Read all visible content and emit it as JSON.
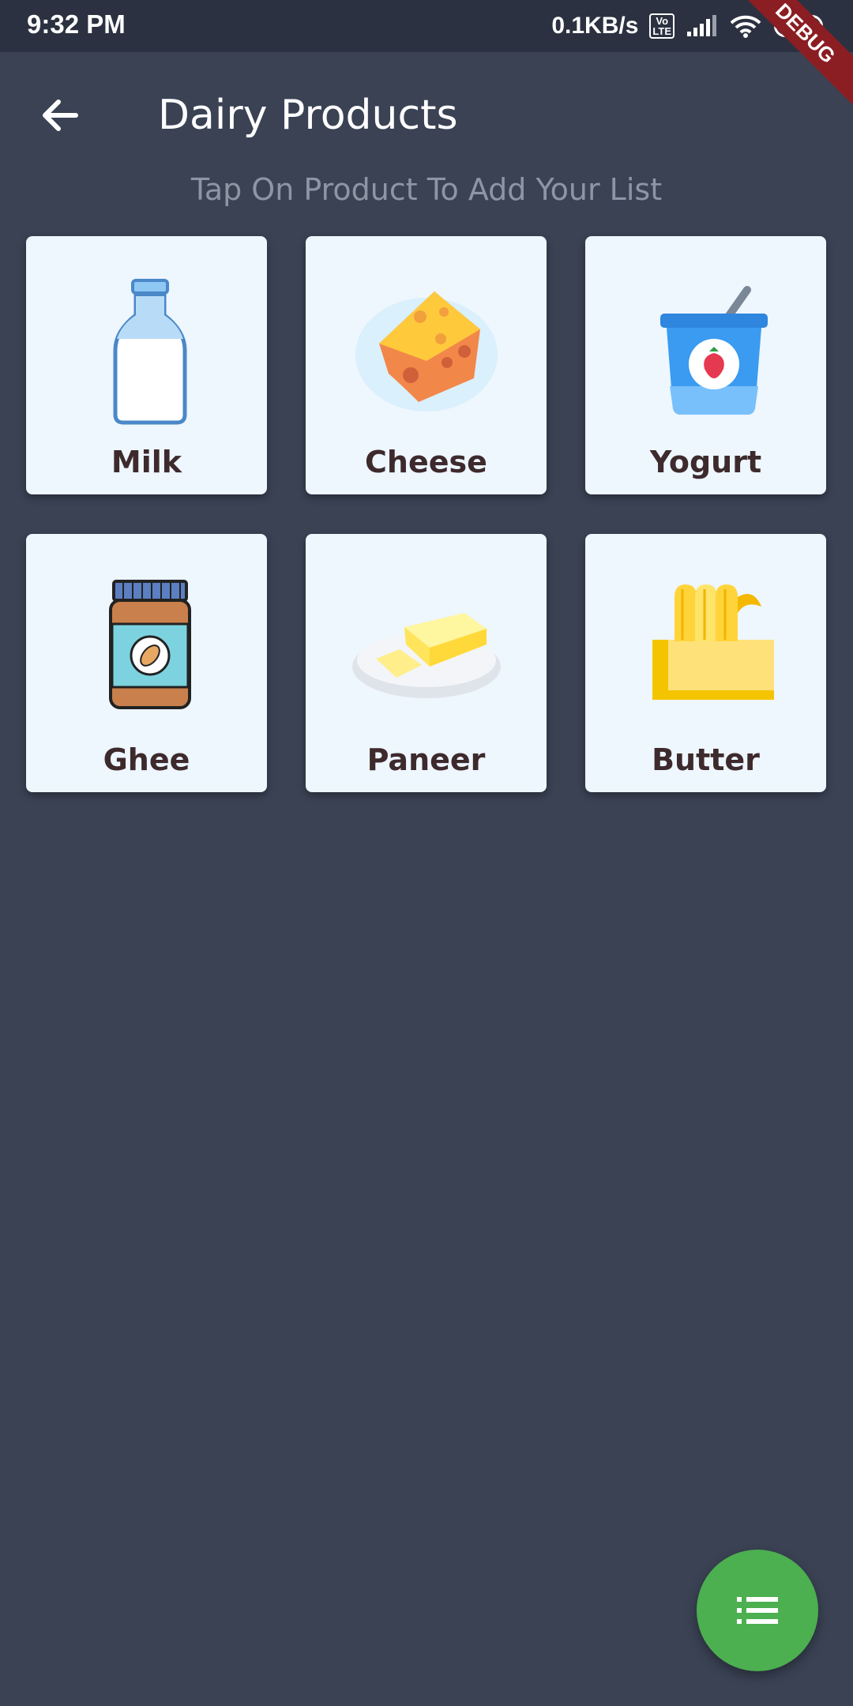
{
  "status_bar": {
    "time": "9:32 PM",
    "network_speed": "0.1KB/s",
    "volte_top": "Vo",
    "volte_bottom": "LTE",
    "battery": "87"
  },
  "debug_banner": "DEBUG",
  "app_bar": {
    "title": "Dairy Products",
    "back_icon": "arrow-back-icon"
  },
  "subtitle": "Tap On Product To Add Your List",
  "products": [
    {
      "label": "Milk",
      "icon": "milk-bottle-icon"
    },
    {
      "label": "Cheese",
      "icon": "cheese-icon"
    },
    {
      "label": "Yogurt",
      "icon": "yogurt-icon"
    },
    {
      "label": "Ghee",
      "icon": "ghee-jar-icon"
    },
    {
      "label": "Paneer",
      "icon": "paneer-icon"
    },
    {
      "label": "Butter",
      "icon": "butter-icon"
    }
  ],
  "fab": {
    "icon": "list-icon",
    "color": "#4caf50"
  },
  "colors": {
    "background": "#3a4254",
    "card": "#eef6fe",
    "label_text": "#3d2a2d",
    "subtitle_text": "#8e95a3"
  }
}
